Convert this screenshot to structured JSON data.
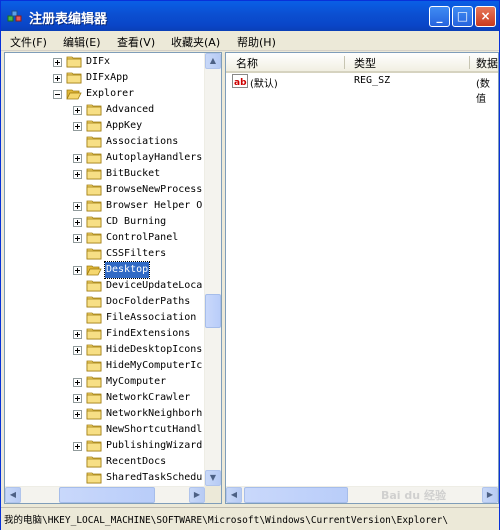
{
  "window": {
    "title": "注册表编辑器",
    "btn_min": "_",
    "btn_max": "□",
    "btn_close": "×"
  },
  "menu": [
    "文件(F)",
    "编辑(E)",
    "查看(V)",
    "收藏夹(A)",
    "帮助(H)"
  ],
  "tree": {
    "items": [
      {
        "label": "DIFx",
        "level": 0,
        "expander": "plus"
      },
      {
        "label": "DIFxApp",
        "level": 0,
        "expander": "plus"
      },
      {
        "label": "Explorer",
        "level": 0,
        "expander": "minus",
        "open": true
      },
      {
        "label": "Advanced",
        "level": 1,
        "expander": "plus"
      },
      {
        "label": "AppKey",
        "level": 1,
        "expander": "plus"
      },
      {
        "label": "Associations",
        "level": 1,
        "expander": "none"
      },
      {
        "label": "AutoplayHandlers",
        "level": 1,
        "expander": "plus"
      },
      {
        "label": "BitBucket",
        "level": 1,
        "expander": "plus"
      },
      {
        "label": "BrowseNewProcess",
        "level": 1,
        "expander": "none"
      },
      {
        "label": "Browser Helper O",
        "level": 1,
        "expander": "plus"
      },
      {
        "label": "CD Burning",
        "level": 1,
        "expander": "plus"
      },
      {
        "label": "ControlPanel",
        "level": 1,
        "expander": "plus"
      },
      {
        "label": "CSSFilters",
        "level": 1,
        "expander": "none"
      },
      {
        "label": "Desktop",
        "level": 1,
        "expander": "plus",
        "selected": true,
        "open": true
      },
      {
        "label": "DeviceUpdateLoca",
        "level": 1,
        "expander": "none"
      },
      {
        "label": "DocFolderPaths",
        "level": 1,
        "expander": "none"
      },
      {
        "label": "FileAssociation",
        "level": 1,
        "expander": "none"
      },
      {
        "label": "FindExtensions",
        "level": 1,
        "expander": "plus"
      },
      {
        "label": "HideDesktopIcons",
        "level": 1,
        "expander": "plus"
      },
      {
        "label": "HideMyComputerIc",
        "level": 1,
        "expander": "none"
      },
      {
        "label": "MyComputer",
        "level": 1,
        "expander": "plus"
      },
      {
        "label": "NetworkCrawler",
        "level": 1,
        "expander": "plus"
      },
      {
        "label": "NetworkNeighborh",
        "level": 1,
        "expander": "plus"
      },
      {
        "label": "NewShortcutHandl",
        "level": 1,
        "expander": "none"
      },
      {
        "label": "PublishingWizard",
        "level": 1,
        "expander": "plus"
      },
      {
        "label": "RecentDocs",
        "level": 1,
        "expander": "none"
      },
      {
        "label": "SharedTaskSchedu",
        "level": 1,
        "expander": "none"
      }
    ]
  },
  "values": {
    "columns": [
      "名称",
      "类型",
      "数据"
    ],
    "rows": [
      {
        "name": "(默认)",
        "type": "REG_SZ",
        "data": "(数值"
      }
    ],
    "type_icon": "ab"
  },
  "status": "我的电脑\\HKEY_LOCAL_MACHINE\\SOFTWARE\\Microsoft\\Windows\\CurrentVersion\\Explorer\\",
  "watermark": "Bai du 经验",
  "colors": {
    "titlebar": "#0b4fd1",
    "selection": "#316ac5",
    "folder": "#f5d76e"
  }
}
